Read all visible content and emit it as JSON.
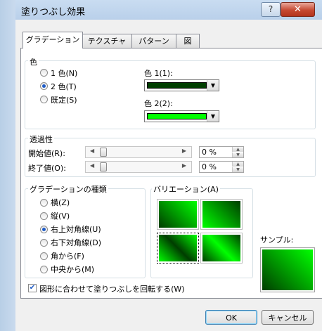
{
  "dialog": {
    "title": "塗りつぶし効果",
    "help_glyph": "?",
    "close_glyph": "✕"
  },
  "tabs": [
    {
      "label": "グラデーション",
      "selected": true
    },
    {
      "label": "テクスチャ",
      "selected": false
    },
    {
      "label": "パターン",
      "selected": false
    },
    {
      "label": "図",
      "selected": false
    }
  ],
  "colors_group": {
    "label": "色",
    "options": [
      {
        "label": "1 色(N)",
        "selected": false
      },
      {
        "label": "2 色(T)",
        "selected": true
      },
      {
        "label": "既定(S)",
        "selected": false
      }
    ],
    "color1": {
      "label": "色 1(1):",
      "value": "#003d00"
    },
    "color2": {
      "label": "色 2(2):",
      "value": "#00ff00"
    }
  },
  "transparency": {
    "label": "透過性",
    "start": {
      "label": "開始値(R):",
      "value": "0 %"
    },
    "end": {
      "label": "終了値(O):",
      "value": "0 %"
    }
  },
  "gradient_type": {
    "label": "グラデーションの種類",
    "options": [
      {
        "label": "横(Z)",
        "selected": false
      },
      {
        "label": "縦(V)",
        "selected": false
      },
      {
        "label": "右上対角線(U)",
        "selected": true
      },
      {
        "label": "右下対角線(D)",
        "selected": false
      },
      {
        "label": "角から(F)",
        "selected": false
      },
      {
        "label": "中央から(M)",
        "selected": false
      }
    ]
  },
  "variations": {
    "label": "バリエーション(A)"
  },
  "sample": {
    "label": "サンプル:"
  },
  "rotate_checkbox": {
    "label": "図形に合わせて塗りつぶしを回転する(W)",
    "checked": true
  },
  "buttons": {
    "ok": "OK",
    "cancel": "キャンセル"
  },
  "theme": {
    "accent": "#1e5bc6",
    "dark_green": "#003d00",
    "bright_green": "#00ff00"
  }
}
